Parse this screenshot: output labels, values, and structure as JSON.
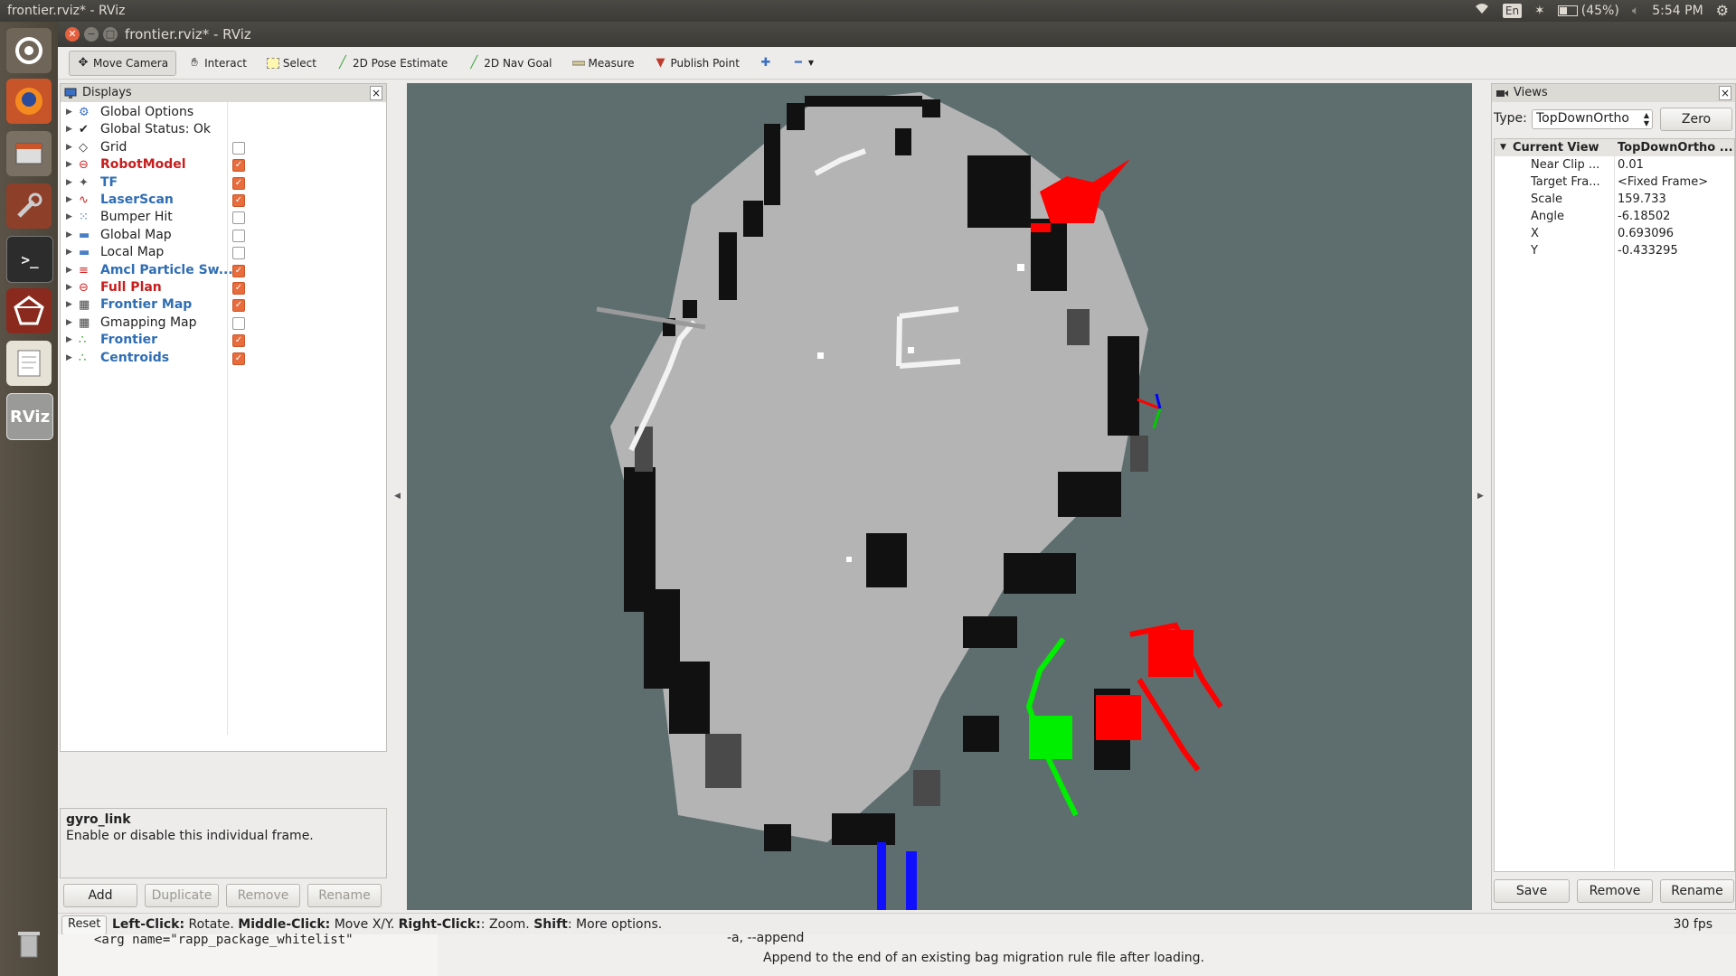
{
  "top_panel": {
    "title": "frontier.rviz* - RViz",
    "keyboard": "En",
    "battery": "(45%)",
    "time": "5:54 PM"
  },
  "launcher": {
    "items": [
      "dash-home",
      "firefox",
      "file-manager",
      "system-settings",
      "terminal",
      "rviz-logo",
      "text-editor",
      "rviz",
      "trash"
    ]
  },
  "window": {
    "title": "frontier.rviz* - RViz"
  },
  "toolbar": {
    "tools": [
      {
        "label": "Move Camera"
      },
      {
        "label": "Interact"
      },
      {
        "label": "Select"
      },
      {
        "label": "2D Pose Estimate"
      },
      {
        "label": "2D Nav Goal"
      },
      {
        "label": "Measure"
      },
      {
        "label": "Publish Point"
      }
    ]
  },
  "displays": {
    "title": "Displays",
    "items": [
      {
        "label": "Global Options",
        "style": "normal",
        "checkbox": null
      },
      {
        "label": "Global Status: Ok",
        "style": "normal",
        "checkbox": null
      },
      {
        "label": "Grid",
        "style": "normal",
        "checkbox": false
      },
      {
        "label": "RobotModel",
        "style": "red",
        "checkbox": true
      },
      {
        "label": "TF",
        "style": "blue",
        "checkbox": true
      },
      {
        "label": "LaserScan",
        "style": "blue",
        "checkbox": true
      },
      {
        "label": "Bumper Hit",
        "style": "normal",
        "checkbox": false
      },
      {
        "label": "Global Map",
        "style": "normal",
        "checkbox": false
      },
      {
        "label": "Local Map",
        "style": "normal",
        "checkbox": false
      },
      {
        "label": "Amcl Particle Sw...",
        "style": "blue",
        "checkbox": true
      },
      {
        "label": "Full Plan",
        "style": "red",
        "checkbox": true
      },
      {
        "label": "Frontier Map",
        "style": "blue",
        "checkbox": true
      },
      {
        "label": "Gmapping Map",
        "style": "normal",
        "checkbox": false
      },
      {
        "label": "Frontier",
        "style": "blue",
        "checkbox": true
      },
      {
        "label": "Centroids",
        "style": "blue",
        "checkbox": true
      }
    ],
    "description_title": "gyro_link",
    "description_text": "Enable or disable this individual frame.",
    "buttons": {
      "add": "Add",
      "duplicate": "Duplicate",
      "remove": "Remove",
      "rename": "Rename"
    }
  },
  "views": {
    "title": "Views",
    "type_label": "Type:",
    "type_value": "TopDownOrtho",
    "zero_label": "Zero",
    "current_view_label": "Current View",
    "current_view_value": "TopDownOrtho ...",
    "props": [
      {
        "key": "Near Clip ...",
        "value": "0.01"
      },
      {
        "key": "Target Fra...",
        "value": "<Fixed Frame>"
      },
      {
        "key": "Scale",
        "value": "159.733"
      },
      {
        "key": "Angle",
        "value": "-6.18502"
      },
      {
        "key": "X",
        "value": "0.693096"
      },
      {
        "key": "Y",
        "value": "-0.433295"
      }
    ],
    "buttons": {
      "save": "Save",
      "remove": "Remove",
      "rename": "Rename"
    }
  },
  "status": {
    "reset": "Reset",
    "hint_1_bold": "Left-Click:",
    "hint_1": " Rotate. ",
    "hint_2_bold": "Middle-Click:",
    "hint_2": " Move X/Y. ",
    "hint_3_bold": "Right-Click:",
    "hint_3": ": Zoom. ",
    "hint_4_bold": "Shift",
    "hint_4": ": More options.",
    "fps": "30 fps"
  },
  "background": {
    "terminal_line": "<arg name=\"rapp_package_whitelist\"",
    "man_flag": "-a, --append",
    "man_text": "Append to the end of an existing bag migration rule file after loading."
  },
  "colors": {
    "map_background": "#5e6e6e",
    "free_space": "#b4b4b4",
    "occupied": "#111111",
    "frontier": "#ff0000",
    "plan": "#00ee00",
    "robot": "#1010ff"
  }
}
